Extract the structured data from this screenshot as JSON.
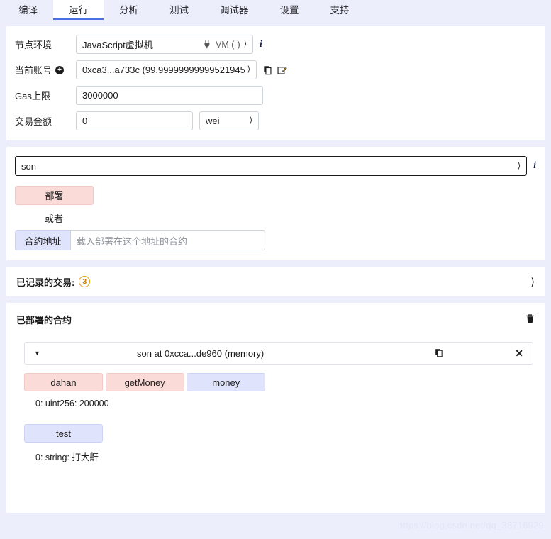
{
  "tabs": [
    {
      "label": "编译",
      "active": false
    },
    {
      "label": "运行",
      "active": true
    },
    {
      "label": "分析",
      "active": false
    },
    {
      "label": "测试",
      "active": false
    },
    {
      "label": "调试器",
      "active": false
    },
    {
      "label": "设置",
      "active": false
    },
    {
      "label": "支持",
      "active": false
    }
  ],
  "settings": {
    "environment": {
      "label": "节点环境",
      "value": "JavaScript虚拟机",
      "status": "VM (-)",
      "plug_icon": "plug-icon",
      "info_icon": "info-icon"
    },
    "account": {
      "label": "当前账号",
      "value": "0xca3...a733c (99.99999999999521945",
      "add_icon": "plus-circle-icon",
      "copy_icon": "copy-icon",
      "edit_icon": "edit-icon"
    },
    "gas_limit": {
      "label": "Gas上限",
      "value": "3000000"
    },
    "value": {
      "label": "交易金额",
      "value": "0",
      "unit": "wei"
    }
  },
  "deploy": {
    "contract_selected": "son",
    "info_icon": "info-icon",
    "deploy_label": "部署",
    "or_label": "或者",
    "at_address_label": "合约地址",
    "at_address_placeholder": "载入部署在这个地址的合约"
  },
  "recorded": {
    "label": "已记录的交易:",
    "count": "3",
    "chevron_icon": "chevron-down-icon"
  },
  "deployed": {
    "title": "已部署的合约",
    "trash_icon": "trash-icon",
    "instance": {
      "caret_icon": "caret-down-icon",
      "title": "son at 0xcca...de960 (memory)",
      "copy_icon": "copy-icon",
      "close_icon": "close-icon"
    },
    "functions": [
      {
        "label": "dahan",
        "kind": "pink",
        "result": null
      },
      {
        "label": "getMoney",
        "kind": "pink",
        "result": null
      },
      {
        "label": "money",
        "kind": "blue",
        "result": "0: uint256: 200000"
      },
      {
        "label": "test",
        "kind": "blue",
        "result": "0: string: 打大鼾"
      }
    ]
  },
  "watermark": "https://blog.csdn.net/qq_38716929",
  "colors": {
    "page_background": "#eceefb",
    "panel": "#ffffff",
    "accent": "#4a6fe0",
    "pink_button": "#fadbd8",
    "blue_button": "#dfe3fb",
    "badge": "#e3a008"
  }
}
